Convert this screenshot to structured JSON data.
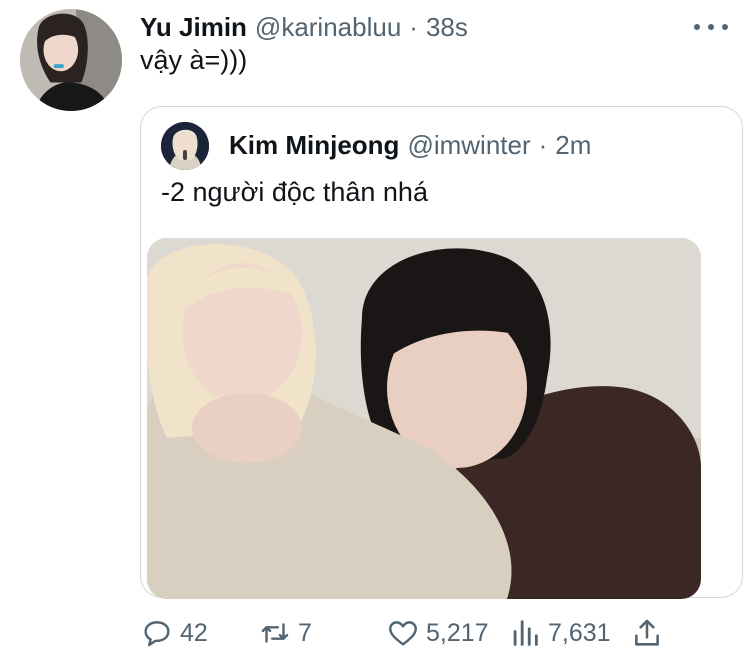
{
  "tweet": {
    "name": "Yu Jimin",
    "handle": "@karinabluu",
    "separator": "·",
    "time": "38s",
    "text": "vậy à=)))",
    "more_icon": "more-horizontal-icon"
  },
  "quoted": {
    "name": "Kim Minjeong",
    "handle": "@imwinter",
    "separator": "·",
    "time": "2m",
    "text": "-2 người độc thân nhá"
  },
  "actions": {
    "replies": "42",
    "retweets": "7",
    "likes": "5,217",
    "views": "7,631"
  },
  "colors": {
    "text": "#0f1419",
    "secondary": "#536471",
    "border": "#cfd9de"
  }
}
